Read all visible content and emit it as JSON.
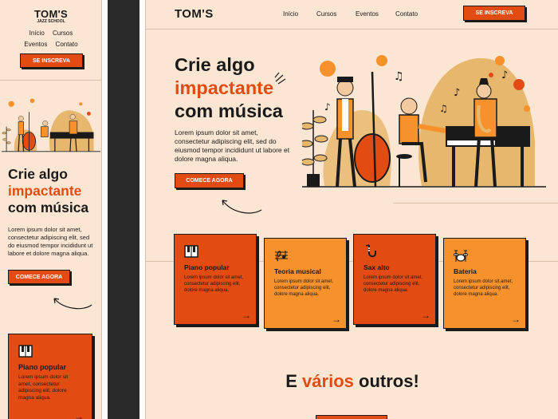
{
  "brand": {
    "name": "TOM'S",
    "tagline": "JAZZ SCHOOL"
  },
  "nav": {
    "items": [
      "Início",
      "Cursos",
      "Eventos",
      "Contato"
    ]
  },
  "cta": {
    "signup": "SE INSCREVA",
    "start": "COMECE AGORA"
  },
  "hero": {
    "title_line1": "Crie algo",
    "title_highlight": "impactante",
    "title_line3": "com música",
    "text": "Lorem ipsum dolor sit amet, consectetur adipiscing elit, sed do eiusmod tempor incididunt ut labore et dolore magna aliqua."
  },
  "cards": [
    {
      "title": "Piano popular",
      "text": "Lorem ipsum dolor sit amet, consectetur adipiscing elit, dolore magna aliqua.",
      "icon": "piano-keys-icon"
    },
    {
      "title": "Teoria musical",
      "text": "Lorem ipsum dolor sit amet, consectetur adipiscing elit, dolore magna aliqua.",
      "icon": "music-staff-icon"
    },
    {
      "title": "Sax alto",
      "text": "Lorem ipsum dolor sit amet, consectetur adipiscing elit, dolore magna aliqua.",
      "icon": "saxophone-icon"
    },
    {
      "title": "Bateria",
      "text": "Lorem ipsum dolor sit amet, consectetur adipiscing elit, dolore magna aliqua.",
      "icon": "drum-kit-icon"
    }
  ],
  "more": {
    "prefix": "E",
    "highlight": "vários",
    "suffix": "outros!"
  },
  "mobile_card": {
    "title": "Piano popular",
    "text": "Lorem ipsum dolor sit amet, consectetur adipiscing elit, dolore magna aliqua."
  },
  "colors": {
    "background": "#fbe6d3",
    "accent": "#e24c12",
    "accent_light": "#f7912c",
    "ink": "#1a1a1a",
    "sand": "#e8b76e"
  }
}
